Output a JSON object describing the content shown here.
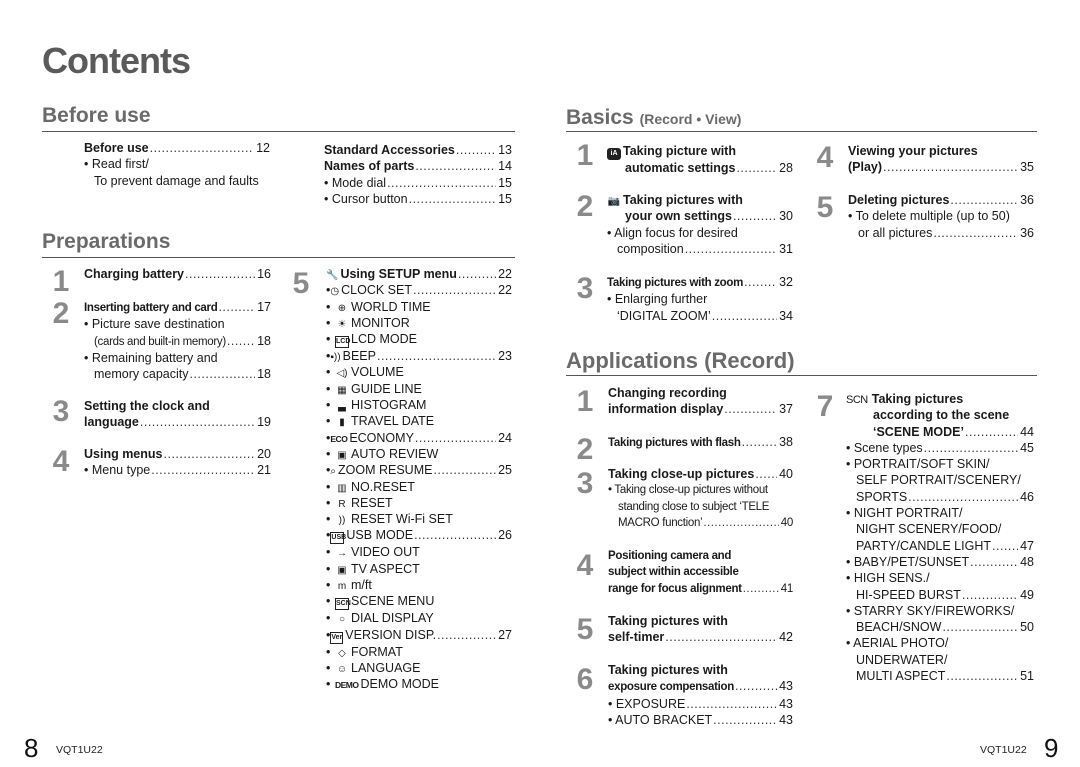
{
  "page_title": "Contents",
  "left_page": {
    "before_use": {
      "title": "Before use",
      "col1": [
        {
          "label": "Before use",
          "bold": true,
          "page": "12"
        },
        {
          "label": "• Read first/",
          "page": ""
        },
        {
          "label": "To prevent damage and faults",
          "page": ""
        }
      ],
      "col2": [
        {
          "label": "Standard Accessories",
          "bold": true,
          "page": "13"
        },
        {
          "label": "Names of parts",
          "bold": true,
          "page": "14"
        },
        {
          "label": "• Mode dial",
          "page": "15"
        },
        {
          "label": "• Cursor button",
          "page": "15"
        }
      ]
    },
    "preparations": {
      "title": "Preparations",
      "steps": [
        {
          "num": "1",
          "lines": [
            {
              "label": "Charging battery",
              "page": "16"
            }
          ]
        },
        {
          "num": "2",
          "lines": [
            {
              "label": "Inserting battery and card",
              "page": "17"
            },
            {
              "label": "• Picture save destination",
              "page": ""
            },
            {
              "label": "(cards and built-in memory)",
              "page": "18"
            },
            {
              "label": "• Remaining battery and",
              "page": ""
            },
            {
              "label": "memory capacity",
              "page": "18"
            }
          ]
        },
        {
          "num": "3",
          "lines": [
            {
              "label": "Setting the clock and",
              "page": ""
            },
            {
              "label": "language",
              "page": "19"
            }
          ]
        },
        {
          "num": "4",
          "lines": [
            {
              "label": "Using menus",
              "page": "20"
            },
            {
              "label": "• Menu type",
              "page": "21"
            }
          ]
        },
        {
          "num": "5",
          "heading": {
            "icon": "wrench-icon",
            "label": "Using SETUP menu",
            "page": "22"
          }
        }
      ],
      "setup_items": [
        {
          "icon": "clock-icon",
          "glyph": "◷",
          "label": "CLOCK SET",
          "page": "22"
        },
        {
          "icon": "world-time-icon",
          "glyph": "⊕",
          "label": "WORLD TIME",
          "page": ""
        },
        {
          "icon": "monitor-brightness-icon",
          "glyph": "☀",
          "label": "MONITOR",
          "page": ""
        },
        {
          "icon": "lcd-mode-icon",
          "glyph": "LCD",
          "label": "LCD MODE",
          "page": ""
        },
        {
          "icon": "beep-icon",
          "glyph": "▪))",
          "label": "BEEP",
          "page": "23"
        },
        {
          "icon": "volume-icon",
          "glyph": "◁)",
          "label": "VOLUME",
          "page": ""
        },
        {
          "icon": "guide-line-icon",
          "glyph": "▦",
          "label": "GUIDE LINE",
          "page": ""
        },
        {
          "icon": "histogram-icon",
          "glyph": "▃",
          "label": "HISTOGRAM",
          "page": ""
        },
        {
          "icon": "travel-date-icon",
          "glyph": "▮",
          "label": "TRAVEL DATE",
          "page": ""
        },
        {
          "icon": "economy-icon",
          "glyph": "ECO",
          "label": "ECONOMY",
          "page": "24"
        },
        {
          "icon": "auto-review-icon",
          "glyph": "▣",
          "label": "AUTO REVIEW",
          "page": ""
        },
        {
          "icon": "zoom-resume-icon",
          "glyph": "⌕",
          "label": "ZOOM RESUME",
          "page": "25"
        },
        {
          "icon": "number-reset-icon",
          "glyph": "▥",
          "label": "NO.RESET",
          "page": ""
        },
        {
          "icon": "reset-icon",
          "glyph": "R",
          "label": "RESET",
          "page": ""
        },
        {
          "icon": "reset-wifi-icon",
          "glyph": "))",
          "label": "RESET Wi-Fi SET",
          "page": ""
        },
        {
          "icon": "usb-mode-icon",
          "glyph": "USB",
          "label": "USB MODE",
          "page": "26"
        },
        {
          "icon": "video-out-icon",
          "glyph": "→",
          "label": "VIDEO OUT",
          "page": ""
        },
        {
          "icon": "tv-aspect-icon",
          "glyph": "▣",
          "label": "TV ASPECT",
          "page": ""
        },
        {
          "icon": "meter-feet-icon",
          "glyph": "m",
          "label": "m/ft",
          "page": ""
        },
        {
          "icon": "scene-menu-icon",
          "glyph": "SCN",
          "label": "SCENE MENU",
          "page": ""
        },
        {
          "icon": "dial-display-icon",
          "glyph": "○",
          "label": "DIAL DISPLAY",
          "page": ""
        },
        {
          "icon": "version-display-icon",
          "glyph": "Ver",
          "label": "VERSION DISP.",
          "page": "27"
        },
        {
          "icon": "format-icon",
          "glyph": "◇",
          "label": "FORMAT",
          "page": ""
        },
        {
          "icon": "language-icon",
          "glyph": "☺",
          "label": "LANGUAGE",
          "page": ""
        },
        {
          "icon": "demo-mode-icon",
          "glyph": "DEMO",
          "label": "DEMO MODE",
          "page": ""
        }
      ]
    },
    "footer": {
      "page_number": "8",
      "code": "VQT1U22"
    }
  },
  "right_page": {
    "basics": {
      "title": "Basics",
      "subtitle": "(Record • View)",
      "steps": [
        {
          "num": "1",
          "icon": "intelligent-auto-icon",
          "glyph": "iA",
          "lines": [
            {
              "label": "Taking picture with",
              "page": ""
            },
            {
              "label": "automatic settings",
              "page": "28"
            }
          ]
        },
        {
          "num": "2",
          "icon": "camera-icon",
          "glyph": "◘",
          "lines": [
            {
              "label": "Taking pictures with",
              "page": ""
            },
            {
              "label": "your own settings",
              "page": "30"
            }
          ],
          "subs": [
            {
              "label": "• Align focus for desired",
              "page": ""
            },
            {
              "label": "composition",
              "page": "31"
            }
          ]
        },
        {
          "num": "3",
          "lines": [
            {
              "label": "Taking pictures with zoom",
              "page": "32"
            }
          ],
          "subs": [
            {
              "label": "• Enlarging further",
              "page": ""
            },
            {
              "label": "‘DIGITAL ZOOM’",
              "page": "34"
            }
          ]
        },
        {
          "num": "4",
          "lines": [
            {
              "label": "Viewing your pictures",
              "page": ""
            },
            {
              "label": "(Play)",
              "page": "35"
            }
          ]
        },
        {
          "num": "5",
          "lines": [
            {
              "label": "Deleting pictures",
              "page": "36"
            }
          ],
          "subs": [
            {
              "label": "• To delete multiple (up to 50)",
              "page": ""
            },
            {
              "label": "or all pictures",
              "page": "36"
            }
          ]
        }
      ]
    },
    "applications": {
      "title": "Applications (Record)",
      "steps": [
        {
          "num": "1",
          "lines": [
            {
              "label": "Changing recording",
              "page": ""
            },
            {
              "label": "information display",
              "page": "37"
            }
          ]
        },
        {
          "num": "2",
          "lines": [
            {
              "label": "Taking pictures with flash",
              "page": "38"
            }
          ]
        },
        {
          "num": "3",
          "lines": [
            {
              "label": "Taking close-up pictures",
              "page": "40"
            }
          ],
          "subs": [
            {
              "label": "• Taking close-up pictures without",
              "page": ""
            },
            {
              "label": "standing close to subject ‘TELE",
              "page": ""
            },
            {
              "label": "MACRO function’",
              "page": "40"
            }
          ]
        },
        {
          "num": "4",
          "lines": [
            {
              "label": "Positioning camera and",
              "page": ""
            },
            {
              "label": "subject within accessible",
              "page": ""
            },
            {
              "label": "range for focus alignment",
              "page": "41"
            }
          ]
        },
        {
          "num": "5",
          "lines": [
            {
              "label": "Taking pictures with",
              "page": ""
            },
            {
              "label": "self-timer",
              "page": "42"
            }
          ]
        },
        {
          "num": "6",
          "lines": [
            {
              "label": "Taking pictures with",
              "page": ""
            },
            {
              "label": "exposure compensation",
              "page": "43"
            }
          ],
          "subs": [
            {
              "label": "• EXPOSURE",
              "page": "43"
            },
            {
              "label": "• AUTO BRACKET",
              "page": "43"
            }
          ]
        },
        {
          "num": "7",
          "icon": "scene-icon",
          "glyph": "SCN",
          "lines": [
            {
              "label": "Taking pictures",
              "page": ""
            },
            {
              "label": "according to the scene",
              "page": ""
            },
            {
              "label": "‘SCENE MODE’",
              "page": "44"
            }
          ],
          "subs": [
            {
              "label": "• Scene types",
              "page": "45"
            },
            {
              "label": "• PORTRAIT/SOFT SKIN/",
              "page": ""
            },
            {
              "label": "SELF PORTRAIT/SCENERY/",
              "page": ""
            },
            {
              "label": "SPORTS",
              "page": "46"
            },
            {
              "label": "• NIGHT PORTRAIT/",
              "page": ""
            },
            {
              "label": "NIGHT SCENERY/FOOD/",
              "page": ""
            },
            {
              "label": "PARTY/CANDLE LIGHT",
              "page": "47"
            },
            {
              "label": "• BABY/PET/SUNSET",
              "page": "48"
            },
            {
              "label": "• HIGH SENS./",
              "page": ""
            },
            {
              "label": "HI-SPEED BURST",
              "page": "49"
            },
            {
              "label": "• STARRY SKY/FIREWORKS/",
              "page": ""
            },
            {
              "label": "BEACH/SNOW",
              "page": "50"
            },
            {
              "label": "• AERIAL PHOTO/",
              "page": ""
            },
            {
              "label": "UNDERWATER/",
              "page": ""
            },
            {
              "label": "MULTI ASPECT",
              "page": "51"
            }
          ]
        }
      ]
    },
    "footer": {
      "page_number": "9",
      "code": "VQT1U22"
    }
  }
}
